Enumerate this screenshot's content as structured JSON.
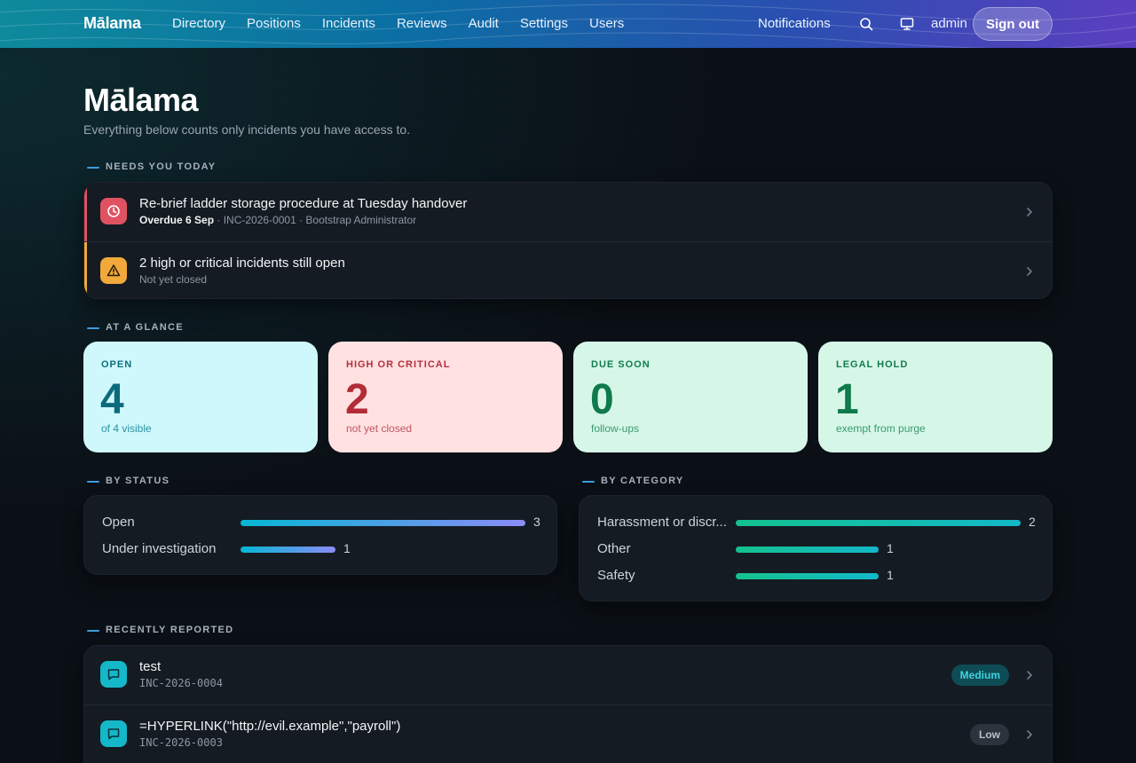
{
  "app": {
    "brand": "Mālama"
  },
  "nav": {
    "items": [
      "Directory",
      "Positions",
      "Incidents",
      "Reviews",
      "Audit",
      "Settings",
      "Users"
    ],
    "notifications": "Notifications",
    "user": "admin",
    "sign_out": "Sign out"
  },
  "header": {
    "title": "Mālama",
    "subtitle": "Everything below counts only incidents you have access to."
  },
  "needs_today": {
    "label": "NEEDS YOU TODAY",
    "items": [
      {
        "title": "Re-brief ladder storage procedure at Tuesday handover",
        "meta_strong": "Overdue 6 Sep",
        "meta_rest": " · INC-2026-0001 · Bootstrap Administrator",
        "icon": "clock-icon",
        "color": "#e05262"
      },
      {
        "title": "2 high or critical incidents still open",
        "meta_strong": "",
        "meta_rest": "Not yet closed",
        "icon": "warning-icon",
        "color": "#f0a93a"
      }
    ]
  },
  "glance": {
    "label": "AT A GLANCE",
    "stats": [
      {
        "label": "OPEN",
        "value": "4",
        "caption": "of 4 visible"
      },
      {
        "label": "HIGH OR CRITICAL",
        "value": "2",
        "caption": "not yet closed"
      },
      {
        "label": "DUE SOON",
        "value": "0",
        "caption": "follow-ups"
      },
      {
        "label": "LEGAL HOLD",
        "value": "1",
        "caption": "exempt from purge"
      }
    ]
  },
  "by_status": {
    "label": "BY STATUS",
    "rows": [
      {
        "name": "Open",
        "value": 3
      },
      {
        "name": "Under investigation",
        "value": 1
      }
    ]
  },
  "by_category": {
    "label": "BY CATEGORY",
    "rows": [
      {
        "name": "Harassment or discr...",
        "value": 2
      },
      {
        "name": "Other",
        "value": 1
      },
      {
        "name": "Safety",
        "value": 1
      }
    ]
  },
  "recent": {
    "label": "RECENTLY REPORTED",
    "items": [
      {
        "title": "test",
        "id": "INC-2026-0004",
        "severity": "Medium"
      },
      {
        "title": "=HYPERLINK(\"http://evil.example\",\"payroll\")",
        "id": "INC-2026-0003",
        "severity": "Low"
      }
    ]
  },
  "colors": {
    "status_bar": "#06b6d4 → #8b8cf6",
    "category_bar": "#14c28e → #13b8c9",
    "severity_medium": "#0e4c55",
    "severity_low": "#2c333c"
  }
}
